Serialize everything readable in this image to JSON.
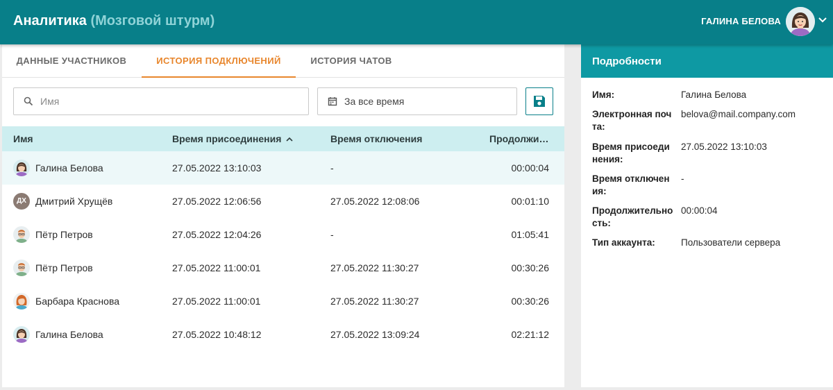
{
  "header": {
    "app_title": "Аналитика",
    "app_subtitle": "(Мозговой штурм)",
    "user_name": "ГАЛИНА БЕЛОВА"
  },
  "tabs": [
    {
      "label": "ДАННЫЕ УЧАСТНИКОВ",
      "active": false
    },
    {
      "label": "ИСТОРИЯ ПОДКЛЮЧЕНИЙ",
      "active": true
    },
    {
      "label": "ИСТОРИЯ ЧАТОВ",
      "active": false
    }
  ],
  "filters": {
    "name_placeholder": "Имя",
    "date_range": "За все время"
  },
  "table": {
    "columns": {
      "name": "Имя",
      "join": "Время присоединения",
      "leave": "Время отключения",
      "duration": "Продолжи…"
    },
    "sort": {
      "column": "join",
      "direction": "ascending"
    },
    "rows": [
      {
        "name": "Галина Белова",
        "join": "27.05.2022 13:10:03",
        "leave": "-",
        "duration": "00:00:04",
        "avatar": "woman-purple-avatar",
        "selected": true
      },
      {
        "name": "Дмитрий Хрущёв",
        "join": "27.05.2022 12:06:56",
        "leave": "27.05.2022 12:08:06",
        "duration": "00:01:10",
        "avatar_initials": "ДХ"
      },
      {
        "name": "Пётр Петров",
        "join": "27.05.2022 12:04:26",
        "leave": "-",
        "duration": "01:05:41",
        "avatar": "man-glasses-avatar"
      },
      {
        "name": "Пётр Петров",
        "join": "27.05.2022 11:00:01",
        "leave": "27.05.2022 11:30:27",
        "duration": "00:30:26",
        "avatar": "man-glasses-avatar"
      },
      {
        "name": "Барбара Краснова",
        "join": "27.05.2022 11:00:01",
        "leave": "27.05.2022 11:30:27",
        "duration": "00:30:26",
        "avatar": "woman-redhead-avatar"
      },
      {
        "name": "Галина Белова",
        "join": "27.05.2022 10:48:12",
        "leave": "27.05.2022 13:09:24",
        "duration": "02:21:12",
        "avatar": "woman-purple-avatar"
      }
    ]
  },
  "details": {
    "title": "Подробности",
    "fields": [
      {
        "label": "Имя:",
        "value": "Галина Белова"
      },
      {
        "label": "Электронная почта:",
        "value": "belova@mail.company.com"
      },
      {
        "label": "Время присоединения:",
        "value": "27.05.2022 13:10:03"
      },
      {
        "label": "Время отключения:",
        "value": "-"
      },
      {
        "label": "Продолжительность:",
        "value": "00:00:04"
      },
      {
        "label": "Тип аккаунта:",
        "value": "Пользователи сервера"
      }
    ]
  },
  "colors": {
    "header_bg": "#087f89",
    "subtitle": "#8fd3d7",
    "accent": "#e8862c",
    "table_header_bg": "#cdeef0",
    "selected_row_bg": "#edf8f9",
    "details_header_bg": "#0e99a3"
  }
}
